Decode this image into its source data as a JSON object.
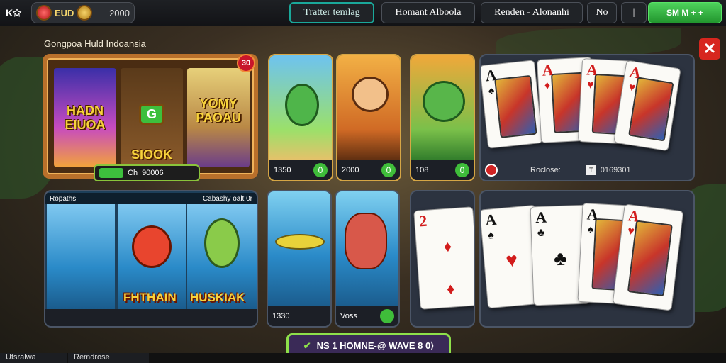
{
  "top": {
    "brand": "K✩",
    "wallet_label": "EUD",
    "wallet_value": "2000",
    "btn1": "Tratter temlag",
    "btn2": "Homant Alboola",
    "btn3": "Renden - Alonanhi",
    "btn4": "No",
    "btn5": "|",
    "btn6": "SM M + +"
  },
  "subtitle": "Gongpoa Huld Indoansia",
  "close_label": "✕",
  "slot": {
    "reel1_text": "HADN\nEIUOA",
    "reel2_text": "SIOOK",
    "reel2_badge": "G",
    "reel3_text": "YOMY\nPAOAU",
    "badge": "30",
    "bar_text": "Ch",
    "bar_value": "90006"
  },
  "tiles": [
    {
      "value": "1350",
      "btn": "0"
    },
    {
      "value": "2000",
      "btn": "0"
    },
    {
      "value": "108",
      "btn": "0"
    }
  ],
  "cards_top": {
    "status_label": "Roclose:",
    "status_value": "0169301",
    "status_square": "T"
  },
  "fishing": {
    "head_left": "Ropaths",
    "head_mid": "Cabashy oalt 0r",
    "label_left": "FHTHAIN",
    "label_right": "HUSKIAK"
  },
  "fish_tiles": [
    {
      "value": "1330"
    },
    {
      "value": "Voss"
    }
  ],
  "banner": {
    "icon": "✔",
    "text": "NS 1 HOMNE-@ WAVE 8 0⟩"
  },
  "bottom": {
    "left_tab": "Utsralwa",
    "left_tab2": "Remdrose"
  },
  "colors": {
    "accent_green": "#3fbd3a",
    "frame_gold": "#b9702b",
    "close_red": "#d7261e"
  }
}
